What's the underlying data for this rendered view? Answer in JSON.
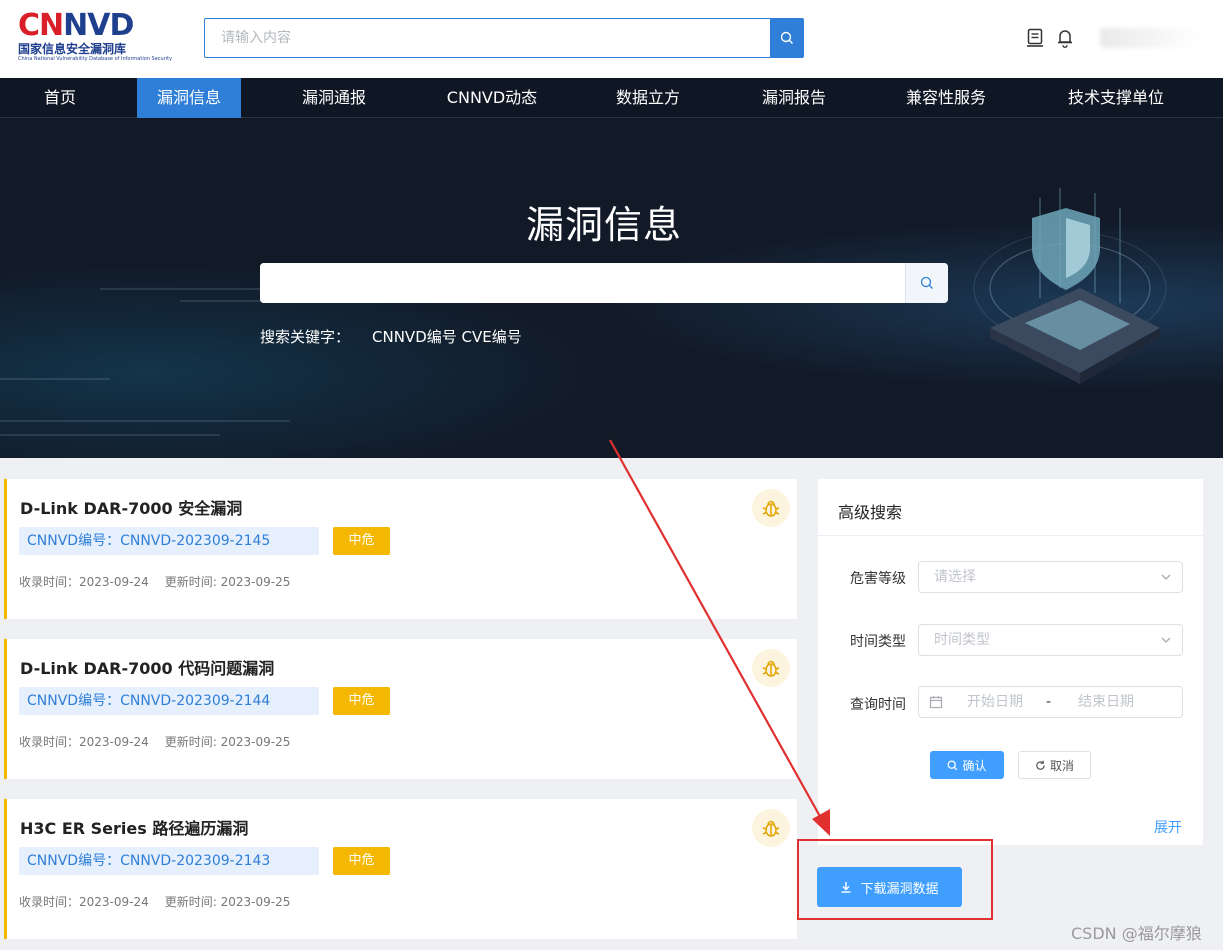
{
  "header": {
    "logo": {
      "mark_c": "C",
      "mark_n": "N",
      "mark_rest": "NVD",
      "cn": "国家信息安全漏洞库",
      "en": "China National Vulnerability Database of Information Security"
    },
    "search_placeholder": "请输入内容"
  },
  "nav": {
    "items": [
      {
        "label": "首页"
      },
      {
        "label": "漏洞信息"
      },
      {
        "label": "漏洞通报"
      },
      {
        "label": "CNNVD动态"
      },
      {
        "label": "数据立方"
      },
      {
        "label": "漏洞报告"
      },
      {
        "label": "兼容性服务"
      },
      {
        "label": "技术支撑单位"
      }
    ],
    "active": "漏洞信息"
  },
  "banner": {
    "title": "漏洞信息",
    "keywords_label": "搜索关键字：",
    "keywords": "CNNVD编号 CVE编号"
  },
  "vulns": [
    {
      "title": "D-Link DAR-7000 安全漏洞",
      "id": "CNNVD编号：CNNVD-202309-2145",
      "level": "中危",
      "recorded": "收录时间：2023-09-24",
      "updated": "更新时间: 2023-09-25"
    },
    {
      "title": "D-Link DAR-7000 代码问题漏洞",
      "id": "CNNVD编号：CNNVD-202309-2144",
      "level": "中危",
      "recorded": "收录时间：2023-09-24",
      "updated": "更新时间: 2023-09-25"
    },
    {
      "title": "H3C ER Series 路径遍历漏洞",
      "id": "CNNVD编号：CNNVD-202309-2143",
      "level": "中危",
      "recorded": "收录时间：2023-09-24",
      "updated": "更新时间: 2023-09-25"
    }
  ],
  "advanced": {
    "title": "高级搜索",
    "severity_label": "危害等级",
    "severity_placeholder": "请选择",
    "time_type_label": "时间类型",
    "time_type_placeholder": "时间类型",
    "query_time_label": "查询时间",
    "start_placeholder": "开始日期",
    "separator": "-",
    "end_placeholder": "结束日期",
    "confirm": "确认",
    "cancel": "取消",
    "expand": "展开"
  },
  "download": "下载漏洞数据",
  "watermark": "CSDN @福尔摩狼",
  "colors": {
    "primary": "#409eff",
    "nav_active": "#2f7fd8",
    "medium": "#f5b800",
    "annotation": "#e03030"
  }
}
